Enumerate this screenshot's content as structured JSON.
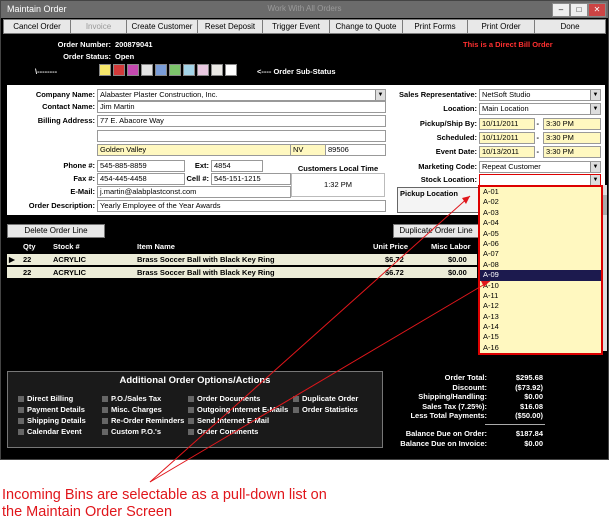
{
  "window": {
    "title": "Maintain Order",
    "inner_title": "Work With All Orders"
  },
  "toolbar": [
    "Cancel Order",
    "Invoice",
    "Create Customer",
    "Reset Deposit",
    "Trigger Event",
    "Change to Quote",
    "Print Forms",
    "Print Order",
    "Done"
  ],
  "order": {
    "number_label": "Order Number:",
    "number": "200879041",
    "status_label": "Order Status:",
    "status": "Open",
    "direct_bill": "This is a Direct Bill Order",
    "substatus_prefix": "\\--------",
    "substatus_label": "<---- Order Sub-Status"
  },
  "customer": {
    "company_label": "Company Name:",
    "company": "Alabaster Plaster Construction, Inc.",
    "contact_label": "Contact Name:",
    "contact": "Jim Martin",
    "billing_label": "Billing Address:",
    "address1": "77 E. Abacore Way",
    "city": "Golden Valley",
    "state": "NV",
    "zip": "89506",
    "phone_label": "Phone #:",
    "phone": "545-885-8859",
    "ext_label": "Ext:",
    "ext": "4854",
    "fax_label": "Fax #:",
    "fax": "454-445-4458",
    "cell_label": "Cell #:",
    "cell": "545-151-1215",
    "email_label": "E-Mail:",
    "email": "j.martin@alabplastconst.com",
    "desc_label": "Order Description:",
    "desc": "Yearly Employee of the Year Awards",
    "local_time_label": "Customers Local Time",
    "local_time": "1:32 PM"
  },
  "right": {
    "rep_label": "Sales Representative:",
    "rep": "NetSoft Studio",
    "loc_label": "Location:",
    "loc": "Main Location",
    "pickup_label": "Pickup/Ship By:",
    "pickup_date": "10/11/2011",
    "pickup_time": "3:30 PM",
    "sched_label": "Scheduled:",
    "sched_date": "10/11/2011",
    "sched_time": "3:30 PM",
    "event_label": "Event Date:",
    "event_date": "10/13/2011",
    "event_time": "3:30 PM",
    "mkt_label": "Marketing Code:",
    "mkt": "Repeat Customer",
    "stock_label": "Stock Location:",
    "pickup_loc_label": "Pickup Location",
    "dash": "-"
  },
  "lines": {
    "delete_btn": "Delete Order Line",
    "dup_btn": "Duplicate Order Line",
    "headers": {
      "qty": "Qty",
      "stock": "Stock #",
      "item": "Item Name",
      "price": "Unit Price",
      "labor": "Misc Labor"
    },
    "rows": [
      {
        "qty": "22",
        "stock": "ACRYLIC",
        "item": "Brass Soccer Ball with Black Key Ring",
        "price": "$6.72",
        "labor": "$0.00"
      },
      {
        "qty": "22",
        "stock": "ACRYLIC",
        "item": "Brass Soccer Ball with Black Key Ring",
        "price": "$6.72",
        "labor": "$0.00"
      }
    ]
  },
  "bins": [
    "A-01",
    "A-02",
    "A-03",
    "A-04",
    "A-05",
    "A-06",
    "A-07",
    "A-08",
    "A-09",
    "A-10",
    "A-11",
    "A-12",
    "A-13",
    "A-14",
    "A-15",
    "A-16"
  ],
  "selected_bin": "A-09",
  "options": {
    "title": "Additional Order Options/Actions",
    "col1": [
      "Direct Billing",
      "Payment Details",
      "Shipping Details",
      "Calendar Event"
    ],
    "col2": [
      "P.O./Sales Tax",
      "Misc. Charges",
      "Re-Order Reminders",
      "Custom P.O.'s"
    ],
    "col3": [
      "Order Documents",
      "Outgoing Internet E-Mails",
      "Send Internet E-Mail",
      "Order Comments"
    ],
    "col4": [
      "Duplicate Order",
      "Order Statistics"
    ]
  },
  "totals": [
    {
      "label": "Order Total:",
      "value": "$295.68"
    },
    {
      "label": "Discount:",
      "value": "($73.92)"
    },
    {
      "label": "Shipping/Handling:",
      "value": "$0.00"
    },
    {
      "label": "Sales Tax (7.25%):",
      "value": "$16.08"
    },
    {
      "label": "Less Total Payments:",
      "value": "($50.00)"
    },
    {
      "label": "Balance Due on Order:",
      "value": "$187.84"
    },
    {
      "label": "Balance Due on Invoice:",
      "value": "$0.00"
    }
  ],
  "caption": {
    "line1": "Incoming Bins are selectable as a pull-down list on",
    "line2": "the Maintain Order Screen"
  },
  "colors": {
    "accent": "#e0161b",
    "selected": "#1c1a4e",
    "field_yellow": "#fff8c0"
  }
}
